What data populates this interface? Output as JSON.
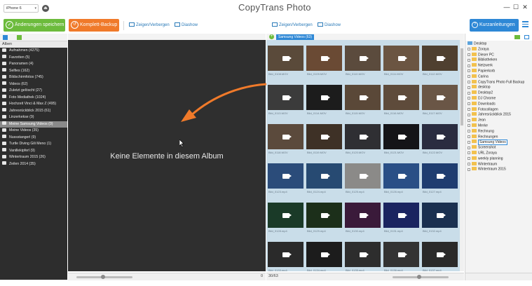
{
  "titlebar": {
    "device": "iPhone 6",
    "app_title": "CopyTrans Photo",
    "eject_icon": "eject-icon"
  },
  "toolbar": {
    "save_label": "Änderungen speichern",
    "backup_label": "Komplett-Backup",
    "show_hide_left": "Zeigen/Verbergen",
    "slideshow_left": "Diashow",
    "show_hide_right": "Zeigen/Verbergen",
    "slideshow_right": "Diashow",
    "guide_label": "Kurzanleitungen",
    "colors": {
      "save": "#6cbb3c",
      "backup": "#f07a2a",
      "guide": "#2e88d6"
    }
  },
  "left_panel": {
    "title": "Alben",
    "albums": [
      {
        "label": "Aufnahmen (4275)",
        "icon": "camera-icon"
      },
      {
        "label": "Favoriten (5)",
        "icon": "heart-icon"
      },
      {
        "label": "Panoramen (4)",
        "icon": "panorama-icon"
      },
      {
        "label": "Selfies (162)",
        "icon": "selfie-icon"
      },
      {
        "label": "Bildschirmfotos (745)",
        "icon": "screenshot-icon"
      },
      {
        "label": "Videos (62)",
        "icon": "video-icon"
      },
      {
        "label": "Zuletzt gelöscht (27)",
        "icon": "trash-icon"
      },
      {
        "label": "Foto Mediathek (1024)",
        "icon": "album-icon"
      },
      {
        "label": "Hochzeit Vinci & Max Z (495)",
        "icon": "album-icon"
      },
      {
        "label": "Jahresrückblick 2015 (61)",
        "icon": "album-icon"
      },
      {
        "label": "Linzerkekse (9)",
        "icon": "album-icon"
      },
      {
        "label": "Meine Samsung Videos (0)",
        "icon": "album-icon",
        "selected": true
      },
      {
        "label": "Meine Videos (35)",
        "icon": "album-icon"
      },
      {
        "label": "Nussstangerl (9)",
        "icon": "album-icon"
      },
      {
        "label": "Turtle Diving Gili Meno (1)",
        "icon": "album-icon"
      },
      {
        "label": "Vanillekipferl (9)",
        "icon": "album-icon"
      },
      {
        "label": "Wintertraum 2015 (26)",
        "icon": "album-icon"
      },
      {
        "label": "Zeilen 2014 (35)",
        "icon": "album-icon"
      }
    ]
  },
  "center": {
    "empty_message": "Keine Elemente in diesem Album",
    "count": "0"
  },
  "middle": {
    "album_badge": "Samsung Videos (63)",
    "count": "30/63",
    "tiles": [
      {
        "label": "Bild_0108.MOV",
        "color": "#5a4a3a"
      },
      {
        "label": "Bild_0109.MOV",
        "color": "#6a4a34"
      },
      {
        "label": "Bild_0110.MOV",
        "color": "#5b4b3d"
      },
      {
        "label": "Bild_0111.MOV",
        "color": "#6b5542"
      },
      {
        "label": "Bild_0112.MOV",
        "color": "#4f4030"
      },
      {
        "label": "Bild_0113.MOV",
        "color": "#3b3b3b"
      },
      {
        "label": "Bild_0114.MOV",
        "color": "#1c1c1c"
      },
      {
        "label": "Bild_0115.MOV",
        "color": "#5a4838"
      },
      {
        "label": "Bild_0116.MOV",
        "color": "#5e4b3b"
      },
      {
        "label": "Bild_0117.MOV",
        "color": "#6a5646"
      },
      {
        "label": "Bild_0118.MOV",
        "color": "#5b4a3c"
      },
      {
        "label": "Bild_0119.MOV",
        "color": "#3e3126"
      },
      {
        "label": "Bild_0120.MOV",
        "color": "#2f2f33"
      },
      {
        "label": "Bild_0121.MOV",
        "color": "#141418"
      },
      {
        "label": "Bild_0122.MOV",
        "color": "#2a2c40"
      },
      {
        "label": "Bild_0123.mp4",
        "color": "#2b4c7a"
      },
      {
        "label": "Bild_0124.mp4",
        "color": "#274a72"
      },
      {
        "label": "Bild_0125.mp4",
        "color": "#8b8a88"
      },
      {
        "label": "Bild_0126.mp4",
        "color": "#2a4f86"
      },
      {
        "label": "Bild_0127.mp4",
        "color": "#1f3d70"
      },
      {
        "label": "Bild_0128.mp4",
        "color": "#1a3a28"
      },
      {
        "label": "Bild_0129.mp4",
        "color": "#1c2f1a"
      },
      {
        "label": "Bild_0130.mp4",
        "color": "#3a1a3a"
      },
      {
        "label": "Bild_0131.mp4",
        "color": "#1a2460"
      },
      {
        "label": "Bild_0132.mp4",
        "color": "#1a3050"
      },
      {
        "label": "Bild_0133.mp4",
        "color": "#2a2a2a"
      },
      {
        "label": "Bild_0134.mp4",
        "color": "#1c1c1c"
      },
      {
        "label": "Bild_0135.mp4",
        "color": "#2d2d2d"
      },
      {
        "label": "Bild_0136.mp4",
        "color": "#333333"
      },
      {
        "label": "Bild_0137.mp4",
        "color": "#2a2a2a"
      }
    ]
  },
  "right_panel": {
    "root": "Desktop",
    "nodes": [
      {
        "label": "Zoraya"
      },
      {
        "label": "Dieser PC"
      },
      {
        "label": "Bibliotheken"
      },
      {
        "label": "Netzwerk"
      },
      {
        "label": "Papierkorb"
      },
      {
        "label": "Carina"
      },
      {
        "label": "CopyTrans Photo Full Backup"
      },
      {
        "label": "desktop"
      },
      {
        "label": "Desktop2"
      },
      {
        "label": "DJ Chrome"
      },
      {
        "label": "Downloads"
      },
      {
        "label": "Fotocollagen"
      },
      {
        "label": "Jahresrückblick 2015"
      },
      {
        "label": "Jean"
      },
      {
        "label": "Merke"
      },
      {
        "label": "Rechnung"
      },
      {
        "label": "Rechnungen"
      },
      {
        "label": "Samsung Videos",
        "selected": true
      },
      {
        "label": "Screenshot"
      },
      {
        "label": "URL Zoraya"
      },
      {
        "label": "weekly planning"
      },
      {
        "label": "Wintertraum"
      },
      {
        "label": "Wintertraum 2015"
      }
    ]
  }
}
